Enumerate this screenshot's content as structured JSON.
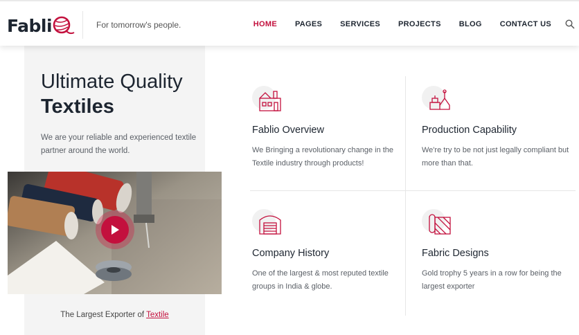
{
  "header": {
    "logo_text": "Fabli",
    "tagline": "For tomorrow's people.",
    "nav": [
      {
        "label": "HOME",
        "active": true
      },
      {
        "label": "PAGES",
        "active": false
      },
      {
        "label": "SERVICES",
        "active": false
      },
      {
        "label": "PROJECTS",
        "active": false
      },
      {
        "label": "BLOG",
        "active": false
      },
      {
        "label": "CONTACT US",
        "active": false
      }
    ],
    "search_icon": "search-icon"
  },
  "hero": {
    "title_line1": "Ultimate Quality",
    "title_line2": "Textiles",
    "description": "We are your reliable and experienced textile partner around the world.",
    "video_play_icon": "play-icon",
    "caption_prefix": "The Largest Exporter of ",
    "caption_link": "Textile"
  },
  "features": [
    {
      "icon": "factory-icon",
      "title": "Fablio Overview",
      "description": "We Bringing a revolutionary change in the Textile industry through products!"
    },
    {
      "icon": "sewing-machine-icon",
      "title": "Production Capability",
      "description": "We're try to be not just legally compliant but more than that."
    },
    {
      "icon": "warehouse-icon",
      "title": "Company History",
      "description": "One of the largest & most reputed textile groups in India & globe."
    },
    {
      "icon": "fabric-roll-icon",
      "title": "Fabric Designs",
      "description": "Gold trophy 5 years in a row for being the largest exporter"
    }
  ],
  "colors": {
    "accent": "#c3103d",
    "text_dark": "#1d2530",
    "panel_bg": "#f4f4f4"
  }
}
